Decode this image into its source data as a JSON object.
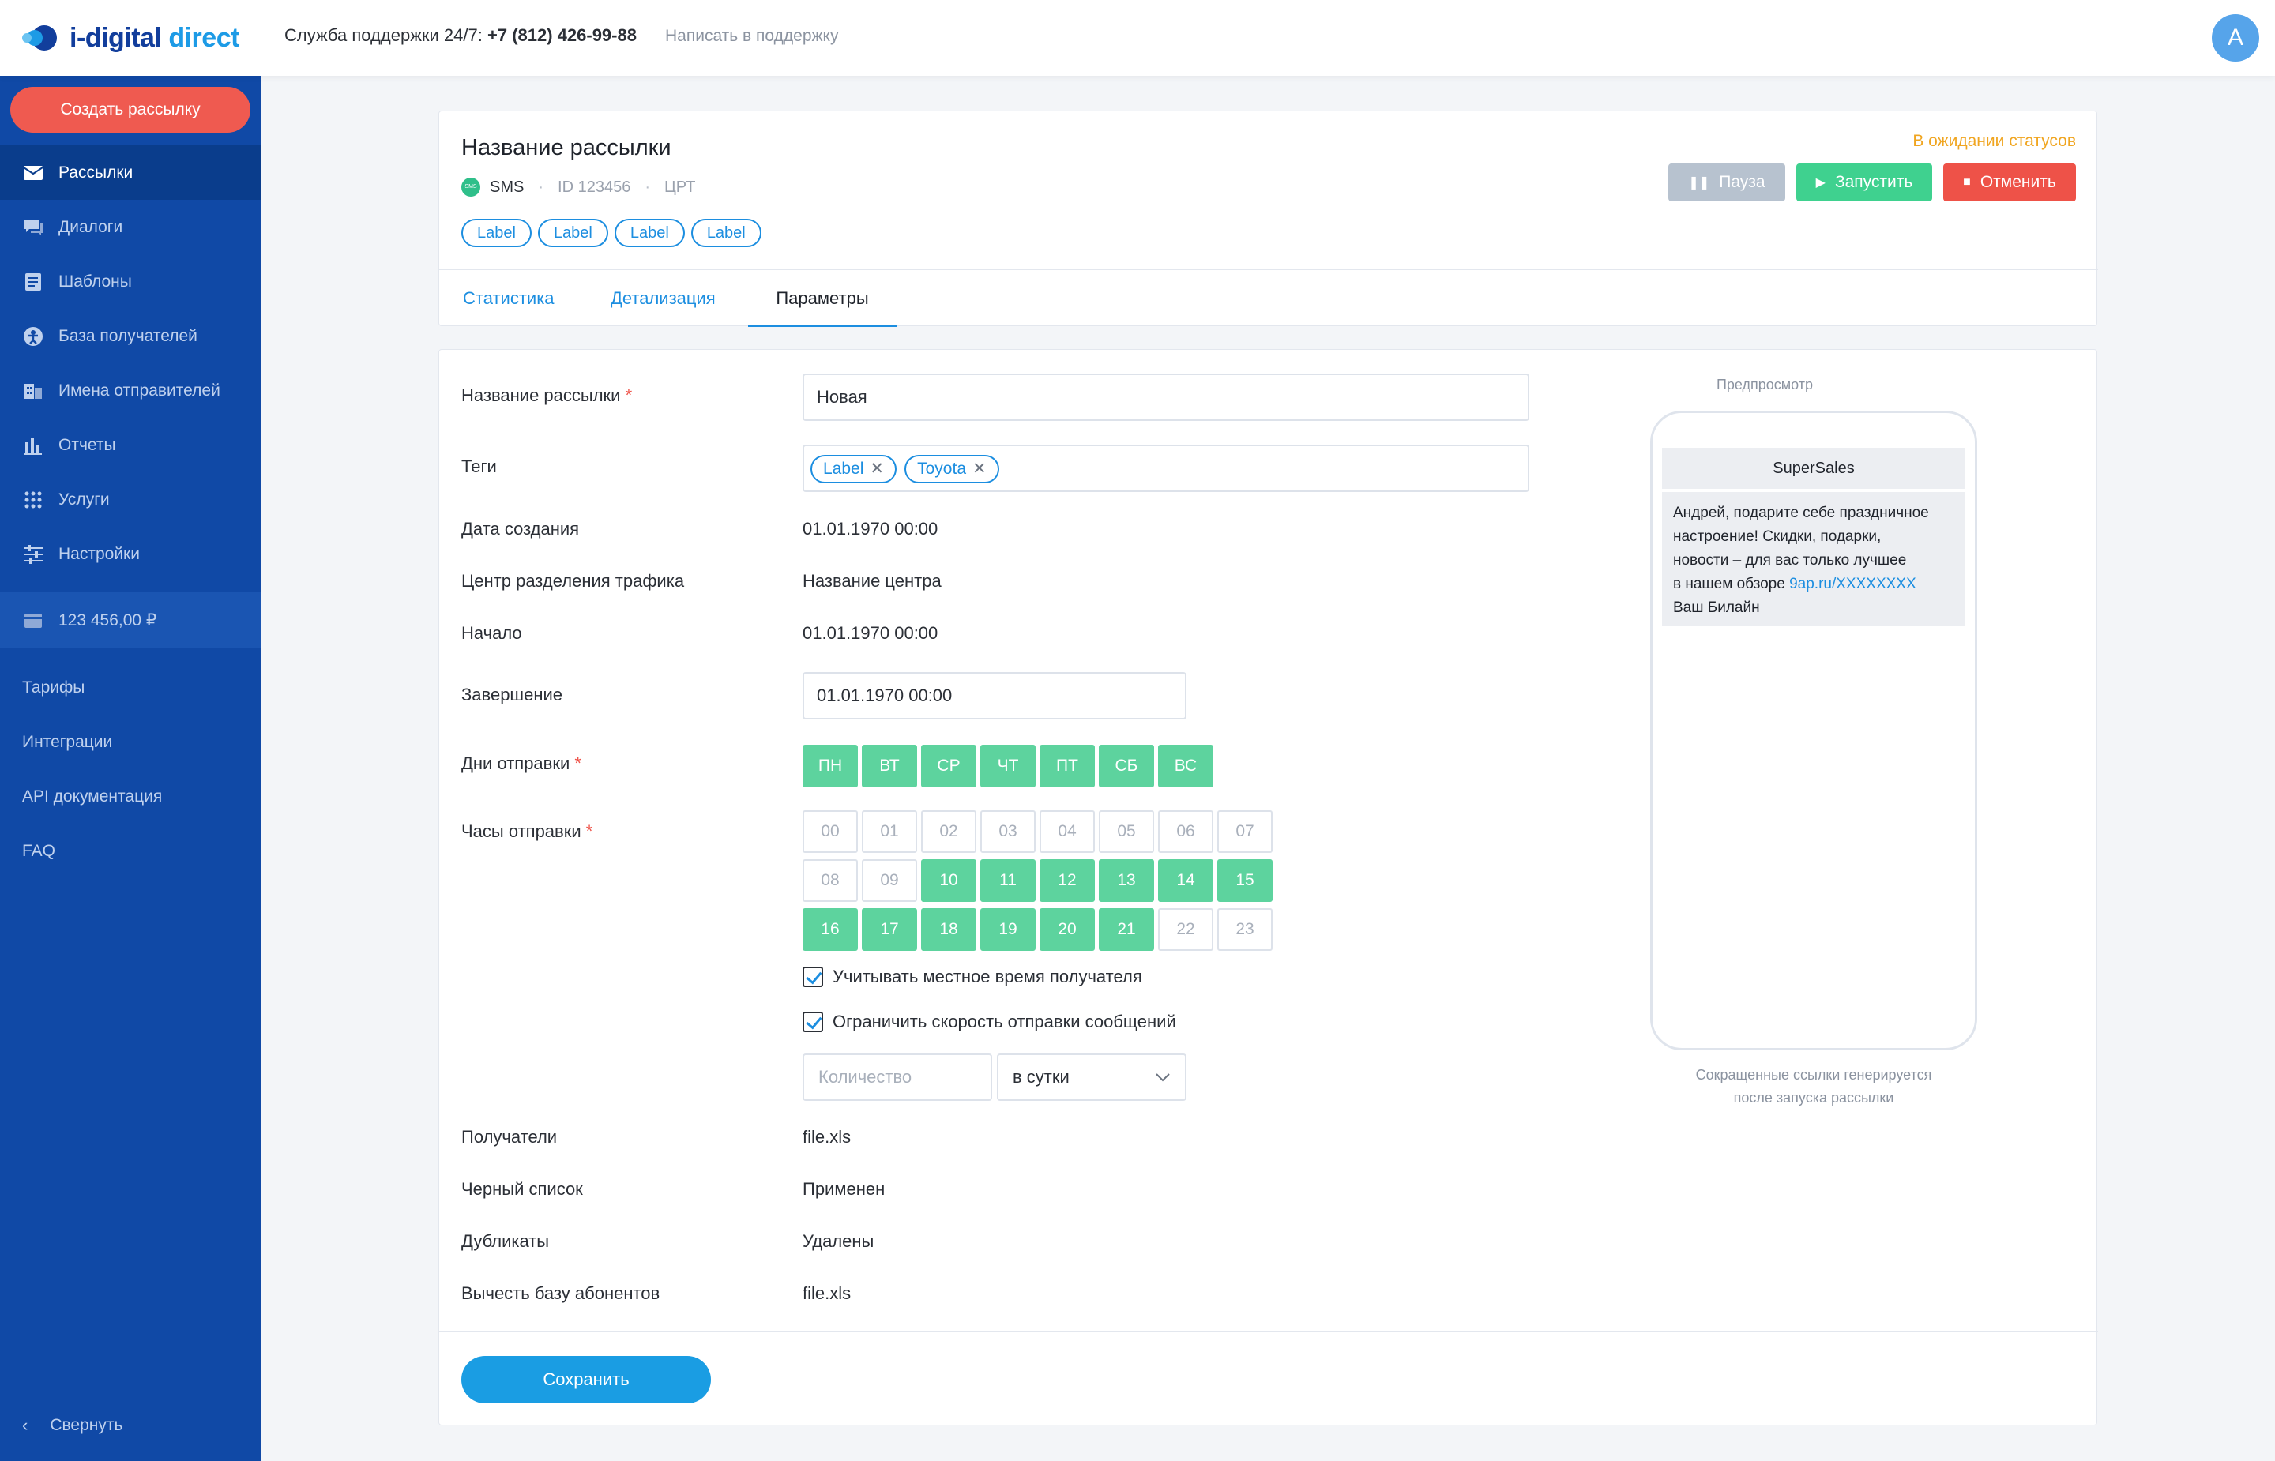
{
  "app": {
    "logo_text_main": "i-digital",
    "logo_text_accent": "direct",
    "support_label": "Служба поддержки 24/7:",
    "support_phone": "+7 (812) 426-99-88",
    "support_link": "Написать в поддержку",
    "avatar_letter": "A"
  },
  "sidebar": {
    "create_button": "Создать рассылку",
    "items": [
      {
        "label": "Рассылки",
        "icon": "envelope-icon"
      },
      {
        "label": "Диалоги",
        "icon": "chat-icon"
      },
      {
        "label": "Шаблоны",
        "icon": "template-icon"
      },
      {
        "label": "База получателей",
        "icon": "recipients-icon"
      },
      {
        "label": "Имена отправителей",
        "icon": "sender-names-icon"
      },
      {
        "label": "Отчеты",
        "icon": "bar-chart-icon"
      },
      {
        "label": "Услуги",
        "icon": "grid-icon"
      },
      {
        "label": "Настройки",
        "icon": "sliders-icon"
      }
    ],
    "balance": "123 456,00 ₽",
    "links": [
      "Тарифы",
      "Интеграции",
      "API документация",
      "FAQ"
    ],
    "collapse": "Свернуть"
  },
  "campaign": {
    "title": "Название рассылки",
    "channel": "SMS",
    "channel_badge": "SMS",
    "id": "ID 123456",
    "center": "ЦРТ",
    "labels": [
      "Label",
      "Label",
      "Label",
      "Label"
    ],
    "status": "В ожидании статусов",
    "actions": {
      "pause": "Пауза",
      "run": "Запустить",
      "cancel": "Отменить"
    },
    "tabs": [
      "Статистика",
      "Детализация",
      "Параметры"
    ]
  },
  "form": {
    "name_label": "Название рассылки",
    "name_value": "Новая",
    "tags_label": "Теги",
    "tags": [
      "Label",
      "Toyota"
    ],
    "created_label": "Дата создания",
    "created_value": "01.01.1970  00:00",
    "center_label": "Центр разделения трафика",
    "center_value": "Название центра",
    "start_label": "Начало",
    "start_value": "01.01.1970  00:00",
    "end_label": "Завершение",
    "end_value": "01.01.1970  00:00",
    "days_label": "Дни отправки",
    "days": [
      "ПН",
      "ВТ",
      "СР",
      "ЧТ",
      "ПТ",
      "СБ",
      "ВС"
    ],
    "hours_label": "Часы отправки",
    "hours": [
      "00",
      "01",
      "02",
      "03",
      "04",
      "05",
      "06",
      "07",
      "08",
      "09",
      "10",
      "11",
      "12",
      "13",
      "14",
      "15",
      "16",
      "17",
      "18",
      "19",
      "20",
      "21",
      "22",
      "23"
    ],
    "hours_selected": [
      "10",
      "11",
      "12",
      "13",
      "14",
      "15",
      "16",
      "17",
      "18",
      "19",
      "20",
      "21"
    ],
    "local_time_label": "Учитывать местное время получателя",
    "local_time_checked": true,
    "limit_label": "Ограничить скорость отправки сообщений",
    "limit_checked": true,
    "qty_placeholder": "Количество",
    "period_value": "в сутки",
    "recipients_label": "Получатели",
    "recipients_value": "file.xls",
    "blacklist_label": "Черный список",
    "blacklist_value": "Применен",
    "duplicates_label": "Дубликаты",
    "duplicates_value": "Удалены",
    "subtract_label": "Вычесть базу абонентов",
    "subtract_value": "file.xls",
    "save_button": "Сохранить"
  },
  "preview": {
    "title": "Предпросмотр",
    "sender": "SuperSales",
    "message_lines": [
      "Андрей, подарите себе праздничное",
      "настроение! Скидки, подарки,",
      "новости – для вас только лучшее"
    ],
    "message_link_prefix": "в нашем обзоре ",
    "message_link": "9ap.ru/XXXXXXXX",
    "message_signature": "Ваш Билайн",
    "note_line1": "Сокращенные ссылки генерируется",
    "note_line2": "после запуска рассылки"
  },
  "colors": {
    "sidebar": "#1049a6",
    "accent": "#1c8ee0",
    "create": "#ef5a50",
    "success": "#3fd18f",
    "danger": "#ee5248",
    "warning": "#f0a520"
  }
}
